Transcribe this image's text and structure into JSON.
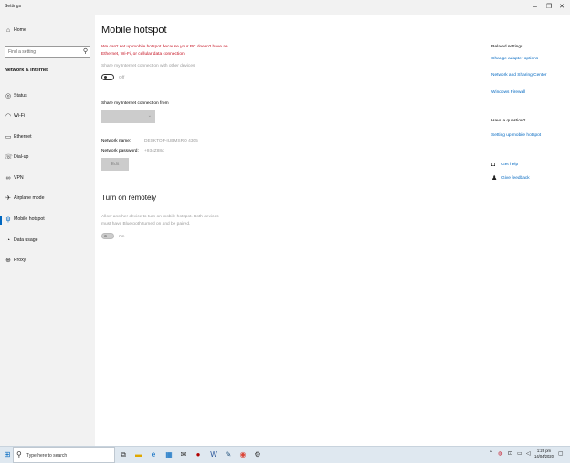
{
  "window": {
    "title": "Settings",
    "minimize_glyph": "–",
    "maximize_glyph": "❐",
    "close_glyph": "✕"
  },
  "sidebar": {
    "home_label": "Home",
    "search_placeholder": "Find a setting",
    "section": "Network & Internet",
    "items": [
      {
        "label": "Status",
        "icon": "globe-icon",
        "glyph": "◎"
      },
      {
        "label": "Wi-Fi",
        "icon": "wifi-icon",
        "glyph": "◠"
      },
      {
        "label": "Ethernet",
        "icon": "ethernet-icon",
        "glyph": "▭"
      },
      {
        "label": "Dial-up",
        "icon": "dialup-icon",
        "glyph": "☏"
      },
      {
        "label": "VPN",
        "icon": "vpn-icon",
        "glyph": "∞"
      },
      {
        "label": "Airplane mode",
        "icon": "airplane-icon",
        "glyph": "✈"
      },
      {
        "label": "Mobile hotspot",
        "icon": "hotspot-icon",
        "glyph": "ψ"
      },
      {
        "label": "Data usage",
        "icon": "data-usage-icon",
        "glyph": "◔"
      },
      {
        "label": "Proxy",
        "icon": "proxy-icon",
        "glyph": "⊕"
      }
    ]
  },
  "main": {
    "title": "Mobile hotspot",
    "warning": "We can't set up mobile hotspot because your PC doesn't have an Ethernet, Wi-Fi, or cellular data connection.",
    "share_label": "Share my Internet connection with other devices",
    "share_toggle_state": "Off",
    "share_from_label": "Share my Internet connection from",
    "network_name_label": "Network name:",
    "network_name_value": "DESKTOP-IUBMSRQ 4305",
    "network_password_label": "Network password:",
    "network_password_value": "+934Z88d",
    "edit_button": "Edit",
    "remote_heading": "Turn on remotely",
    "remote_desc": "Allow another device to turn on mobile hotspot. Both devices must have Bluetooth turned on and be paired.",
    "remote_toggle_state": "On"
  },
  "related": {
    "heading": "Related settings",
    "links": [
      "Change adapter options",
      "Network and Sharing Center",
      "Windows Firewall"
    ],
    "question_heading": "Have a question?",
    "question_link": "Setting up mobile hotspot",
    "get_help": "Get help",
    "give_feedback": "Give feedback"
  },
  "taskbar": {
    "search_placeholder": "Type here to search",
    "time": "1:29 pm",
    "date": "14/04/2020"
  },
  "colors": {
    "accent": "#0067c0",
    "warning": "#c50f1f",
    "sidebar_bg": "#f2f2f2",
    "taskbar_bg": "#dfe8f0"
  }
}
